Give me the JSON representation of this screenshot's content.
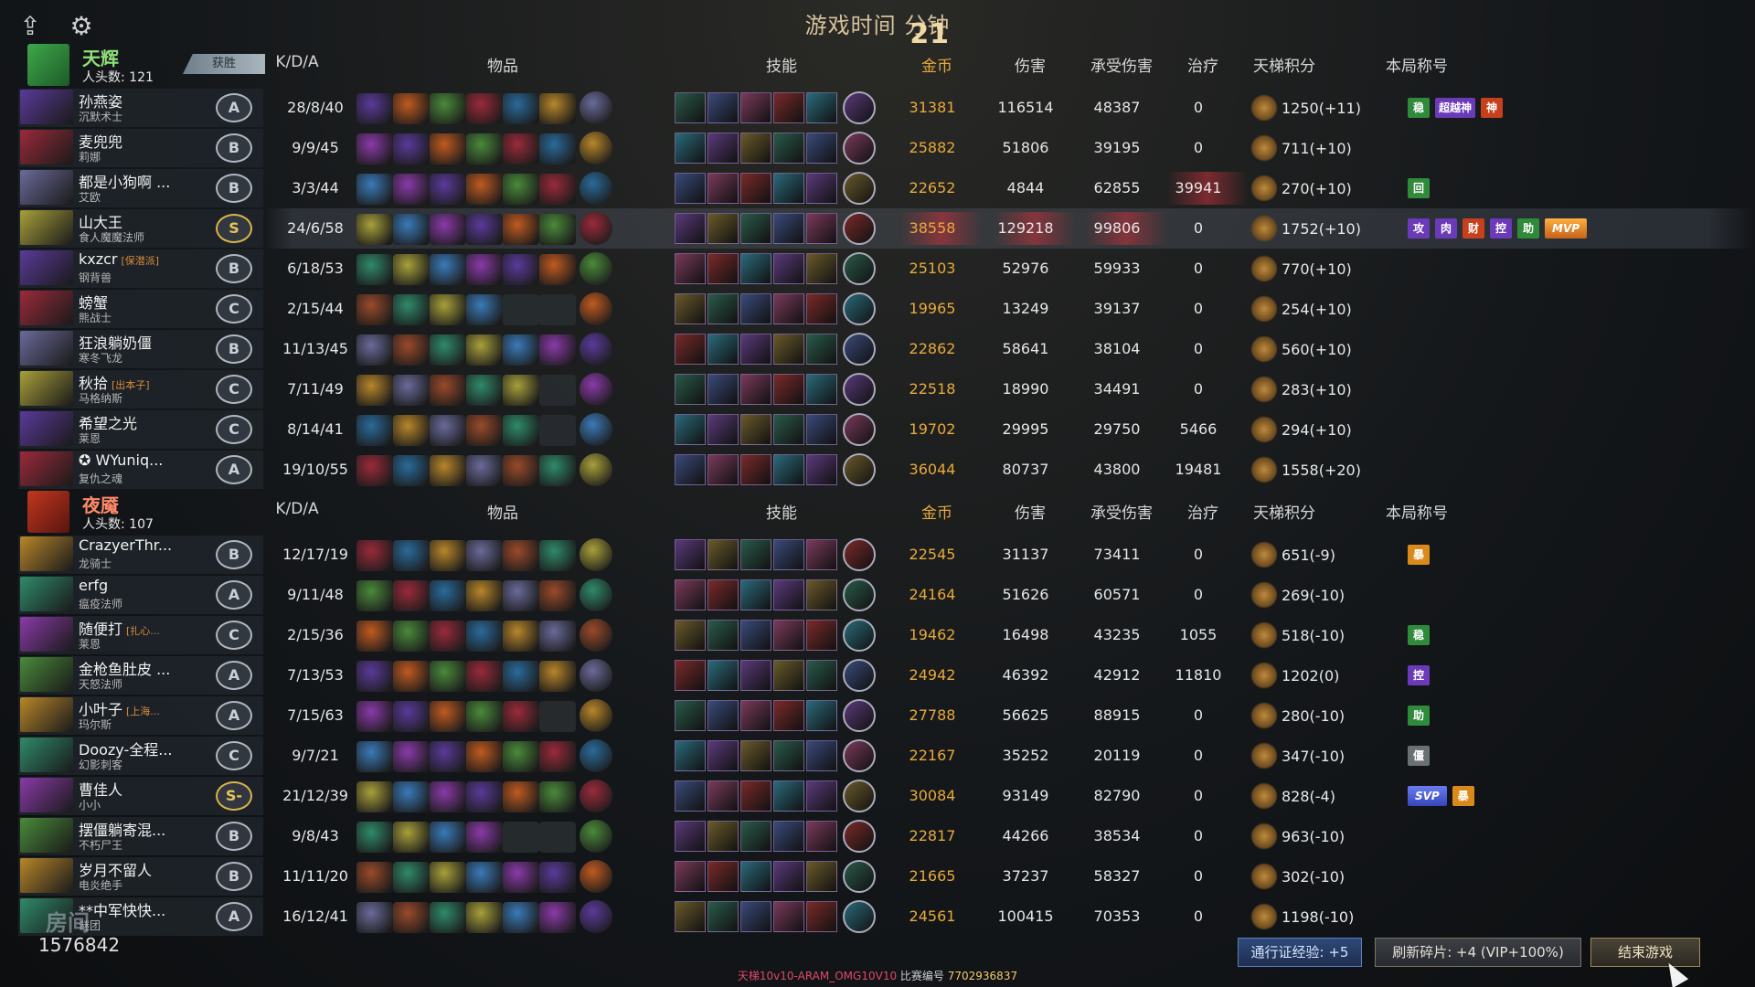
{
  "top_bar": {
    "upload_icon": "upload-icon",
    "settings_icon": "gear-icon"
  },
  "timer": {
    "prefix": "游戏时间",
    "minutes": "21",
    "suffix": "分钟"
  },
  "columns": {
    "kda": "K/D/A",
    "items": "物品",
    "skills": "技能",
    "gold": "金币",
    "damage": "伤害",
    "taken": "承受伤害",
    "heal": "治疗",
    "ladder": "天梯积分",
    "titles": "本局称号"
  },
  "teams": [
    {
      "name": "天辉",
      "kills_label": "人头数: 121",
      "result": "获胜",
      "players": [
        {
          "name": "孙燕姿",
          "tag": "",
          "hero": "沉默术士",
          "rank": "A",
          "kda": "28/8/40",
          "gold": "31381",
          "damage": "116514",
          "taken": "48387",
          "heal": "0",
          "ladder": "1250(+11)",
          "titles": [
            "稳",
            "超越神",
            "神"
          ]
        },
        {
          "name": "麦兜兜",
          "tag": "",
          "hero": "莉娜",
          "rank": "B",
          "kda": "9/9/45",
          "gold": "25882",
          "damage": "51806",
          "taken": "39195",
          "heal": "0",
          "ladder": "711(+10)",
          "titles": []
        },
        {
          "name": "都是小狗啊 ...",
          "tag": "",
          "hero": "艾欧",
          "rank": "B",
          "kda": "3/3/44",
          "gold": "22652",
          "damage": "4844",
          "taken": "62855",
          "heal": "39941",
          "ladder": "270(+10)",
          "titles": [
            "回"
          ]
        },
        {
          "name": "山大王",
          "tag": "",
          "hero": "食人魔魔法师",
          "rank": "S",
          "kda": "24/6/58",
          "gold": "38558",
          "damage": "129218",
          "taken": "99806",
          "heal": "0",
          "ladder": "1752(+10)",
          "titles": [
            "攻",
            "肉",
            "财",
            "控",
            "助",
            "MVP"
          ]
        },
        {
          "name": "kxzcr",
          "tag": "[保潜派]",
          "hero": "钢背兽",
          "rank": "B",
          "kda": "6/18/53",
          "gold": "25103",
          "damage": "52976",
          "taken": "59933",
          "heal": "0",
          "ladder": "770(+10)",
          "titles": []
        },
        {
          "name": "螃蟹",
          "tag": "",
          "hero": "熊战士",
          "rank": "C",
          "kda": "2/15/44",
          "gold": "19965",
          "damage": "13249",
          "taken": "39137",
          "heal": "0",
          "ladder": "254(+10)",
          "titles": []
        },
        {
          "name": "狂浪躺奶僵",
          "tag": "",
          "hero": "寒冬飞龙",
          "rank": "B",
          "kda": "11/13/45",
          "gold": "22862",
          "damage": "58641",
          "taken": "38104",
          "heal": "0",
          "ladder": "560(+10)",
          "titles": []
        },
        {
          "name": "秋拾",
          "tag": "[出本子]",
          "hero": "马格纳斯",
          "rank": "C",
          "kda": "7/11/49",
          "gold": "22518",
          "damage": "18990",
          "taken": "34491",
          "heal": "0",
          "ladder": "283(+10)",
          "titles": []
        },
        {
          "name": "希望之光",
          "tag": "",
          "hero": "莱恩",
          "rank": "C",
          "kda": "8/14/41",
          "gold": "19702",
          "damage": "29995",
          "taken": "29750",
          "heal": "5466",
          "ladder": "294(+10)",
          "titles": []
        },
        {
          "name": "✪ WYuniq...",
          "tag": "",
          "hero": "复仇之魂",
          "rank": "A",
          "kda": "19/10/55",
          "gold": "36044",
          "damage": "80737",
          "taken": "43800",
          "heal": "19481",
          "ladder": "1558(+20)",
          "titles": []
        }
      ]
    },
    {
      "name": "夜魇",
      "kills_label": "人头数: 107",
      "result": "",
      "players": [
        {
          "name": "CrazyerThr...",
          "tag": "",
          "hero": "龙骑士",
          "rank": "B",
          "kda": "12/17/19",
          "gold": "22545",
          "damage": "31137",
          "taken": "73411",
          "heal": "0",
          "ladder": "651(-9)",
          "titles": [
            "暴"
          ]
        },
        {
          "name": "erfg",
          "tag": "",
          "hero": "瘟疫法师",
          "rank": "A",
          "kda": "9/11/48",
          "gold": "24164",
          "damage": "51626",
          "taken": "60571",
          "heal": "0",
          "ladder": "269(-10)",
          "titles": []
        },
        {
          "name": "随便打",
          "tag": "[扎心...",
          "hero": "莱恩",
          "rank": "C",
          "kda": "2/15/36",
          "gold": "19462",
          "damage": "16498",
          "taken": "43235",
          "heal": "1055",
          "ladder": "518(-10)",
          "titles": [
            "稳"
          ]
        },
        {
          "name": "金枪鱼肚皮 ...",
          "tag": "",
          "hero": "天怒法师",
          "rank": "A",
          "kda": "7/13/53",
          "gold": "24942",
          "damage": "46392",
          "taken": "42912",
          "heal": "11810",
          "ladder": "1202(0)",
          "titles": [
            "控"
          ]
        },
        {
          "name": "小叶子",
          "tag": "[上海...",
          "hero": "玛尔斯",
          "rank": "A",
          "kda": "7/15/63",
          "gold": "27788",
          "damage": "56625",
          "taken": "88915",
          "heal": "0",
          "ladder": "280(-10)",
          "titles": [
            "助"
          ]
        },
        {
          "name": "Doozy-全程...",
          "tag": "",
          "hero": "幻影刺客",
          "rank": "C",
          "kda": "9/7/21",
          "gold": "22167",
          "damage": "35252",
          "taken": "20119",
          "heal": "0",
          "ladder": "347(-10)",
          "titles": [
            "僵"
          ]
        },
        {
          "name": "曹佳人",
          "tag": "",
          "hero": "小小",
          "rank": "S-",
          "kda": "21/12/39",
          "gold": "30084",
          "damage": "93149",
          "taken": "82790",
          "heal": "0",
          "ladder": "828(-4)",
          "titles": [
            "SVP",
            "暴"
          ]
        },
        {
          "name": "摆僵躺寄混...",
          "tag": "",
          "hero": "不朽尸王",
          "rank": "B",
          "kda": "9/8/43",
          "gold": "22817",
          "damage": "44266",
          "taken": "38534",
          "heal": "0",
          "ladder": "963(-10)",
          "titles": []
        },
        {
          "name": "岁月不留人",
          "tag": "",
          "hero": "电炎绝手",
          "rank": "B",
          "kda": "11/11/20",
          "gold": "21665",
          "damage": "37237",
          "taken": "58327",
          "heal": "0",
          "ladder": "302(-10)",
          "titles": []
        },
        {
          "name": "**中军快快...",
          "tag": "",
          "hero": "谜团",
          "rank": "A",
          "kda": "16/12/41",
          "gold": "24561",
          "damage": "100415",
          "taken": "70353",
          "heal": "0",
          "ladder": "1198(-10)",
          "titles": []
        }
      ]
    }
  ],
  "bottom": {
    "id": "1576842",
    "watermark": "房间",
    "pass_btn": "通行证经验: +5",
    "shard_btn": "刷新碎片: +4 (VIP+100%)",
    "end_btn": "结束游戏",
    "footer_mode": "天梯10v10-ARAM_OMG10V10",
    "footer_label": " 比赛编号 ",
    "footer_code": "7702936837"
  },
  "colors": {
    "gold": "#e8a93a",
    "highlight_red": "#c8323c",
    "timer": "#d8c29b"
  }
}
